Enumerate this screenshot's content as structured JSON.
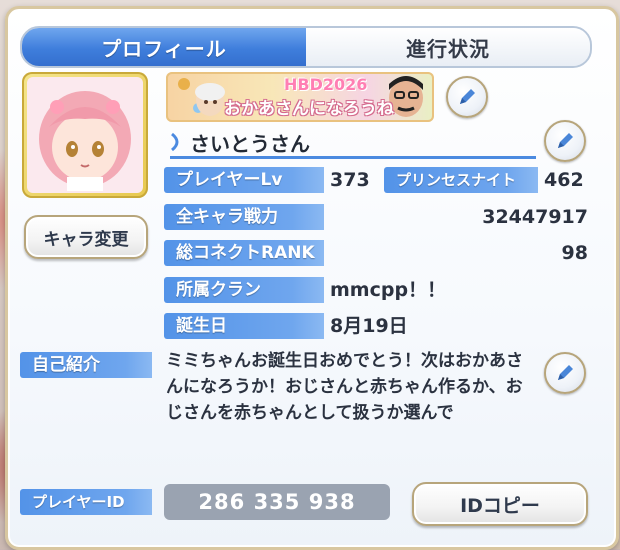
{
  "tabs": [
    {
      "label": "プロフィール",
      "active": true
    },
    {
      "label": "進行状況",
      "active": false
    }
  ],
  "buttons": {
    "change_character": "キャラ変更",
    "copy_id": "IDコピー"
  },
  "banner": {
    "title": "HBD2026",
    "subtitle": "おかあさんになろうね"
  },
  "player": {
    "name": "さいとうさん"
  },
  "stats": {
    "player_level_label": "プレイヤーLv",
    "player_level": "373",
    "princess_knight_label": "プリンセスナイト",
    "princess_knight": "462",
    "total_power_label": "全キャラ戦力",
    "total_power": "32447917",
    "connect_rank_label": "総コネクトRANK",
    "connect_rank": "98",
    "clan_label": "所属クラン",
    "clan": "mmcpp！！",
    "birthday_label": "誕生日",
    "birthday": "8月19日"
  },
  "intro": {
    "label": "自己紹介",
    "text": "ミミちゃんお誕生日おめでとう！次はおかあさんになろうか！おじさんと赤ちゃん作るか、おじさんを赤ちゃんとして扱うか選んで"
  },
  "player_id": {
    "label": "プレイヤーID",
    "value": "286 335 938"
  },
  "colors": {
    "accent_blue": "#3f7edc",
    "label_blue": "#5393e8",
    "frame_gold": "#d8c7a0",
    "id_box_gray": "#9aa3b1"
  },
  "icons": [
    "pencil-icon",
    "sparkle-icon",
    "character-portrait"
  ]
}
